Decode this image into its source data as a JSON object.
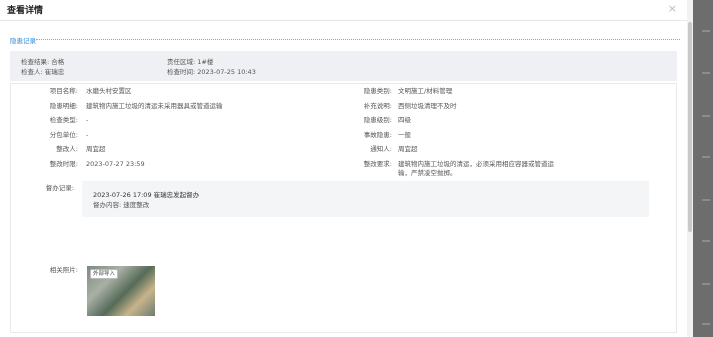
{
  "dialog": {
    "title": "查看详情",
    "close": "×"
  },
  "section": {
    "title": "隐患记录"
  },
  "summary": {
    "result": "检查结果: 合格",
    "inspector": "检查人: 崔瑞忠",
    "area": "责任区域: 1#楼",
    "time": "检查时间: 2023-07-25 10:43"
  },
  "fields_left": [
    {
      "label": "项目名称:",
      "value": "水磨头村安置区"
    },
    {
      "label": "隐患明细:",
      "value": "建筑物内施工垃圾的清运未采用器具或管道运输"
    },
    {
      "label": "检查类型:",
      "value": "-"
    },
    {
      "label": "分包单位:",
      "value": "-"
    },
    {
      "label": "整改人:",
      "value": "周宜超"
    },
    {
      "label": "整改时限:",
      "value": "2023-07-27 23:59"
    }
  ],
  "fields_right": [
    {
      "label": "隐患类别:",
      "value": "文明施工/材料管理"
    },
    {
      "label": "补充说明:",
      "value": "西侧垃圾清理不及时"
    },
    {
      "label": "隐患级别:",
      "value": "四级"
    },
    {
      "label": "事故隐患:",
      "value": "一般"
    },
    {
      "label": "通知人:",
      "value": "周宜超"
    },
    {
      "label": "整改要求:",
      "value": "建筑物内施工垃圾的清运，必须采用相应容器或管道运",
      "value2": "输，严禁凌空抛掷。"
    }
  ],
  "supervise": {
    "label": "督办记录:",
    "line1": "2023-07-26 17:09 崔瑞忠发起督办",
    "line2": "督办内容:  速度整改"
  },
  "photos": {
    "label": "相关照片:",
    "tag": "外部导入"
  }
}
